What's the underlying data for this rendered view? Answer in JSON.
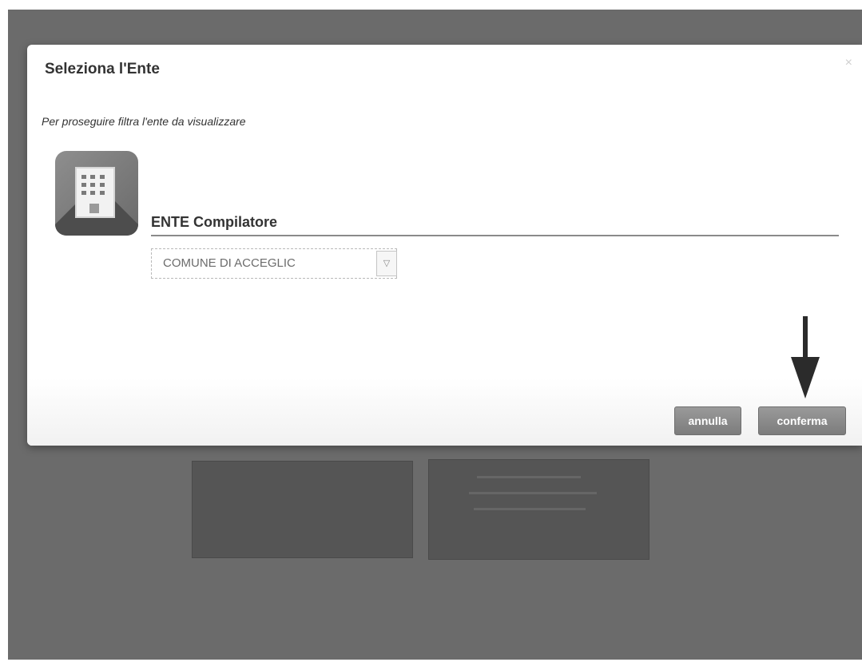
{
  "dialog": {
    "title": "Seleziona l'Ente",
    "close_icon": "close-icon",
    "subtitle": "Per proseguire filtra l'ente da visualizzare",
    "icon": "building-icon",
    "field": {
      "label": "ENTE Compilatore",
      "selected_value": "COMUNE DI ACCEGLIC",
      "dropdown_icon": "chevron-down-icon"
    },
    "buttons": {
      "cancel_label": "annulla",
      "confirm_label": "conferma"
    },
    "annotation": "arrow-down-icon"
  },
  "colors": {
    "backdrop": "#6b6b6b",
    "button": "#8a8a8a",
    "arrow": "#2b2b2b"
  }
}
